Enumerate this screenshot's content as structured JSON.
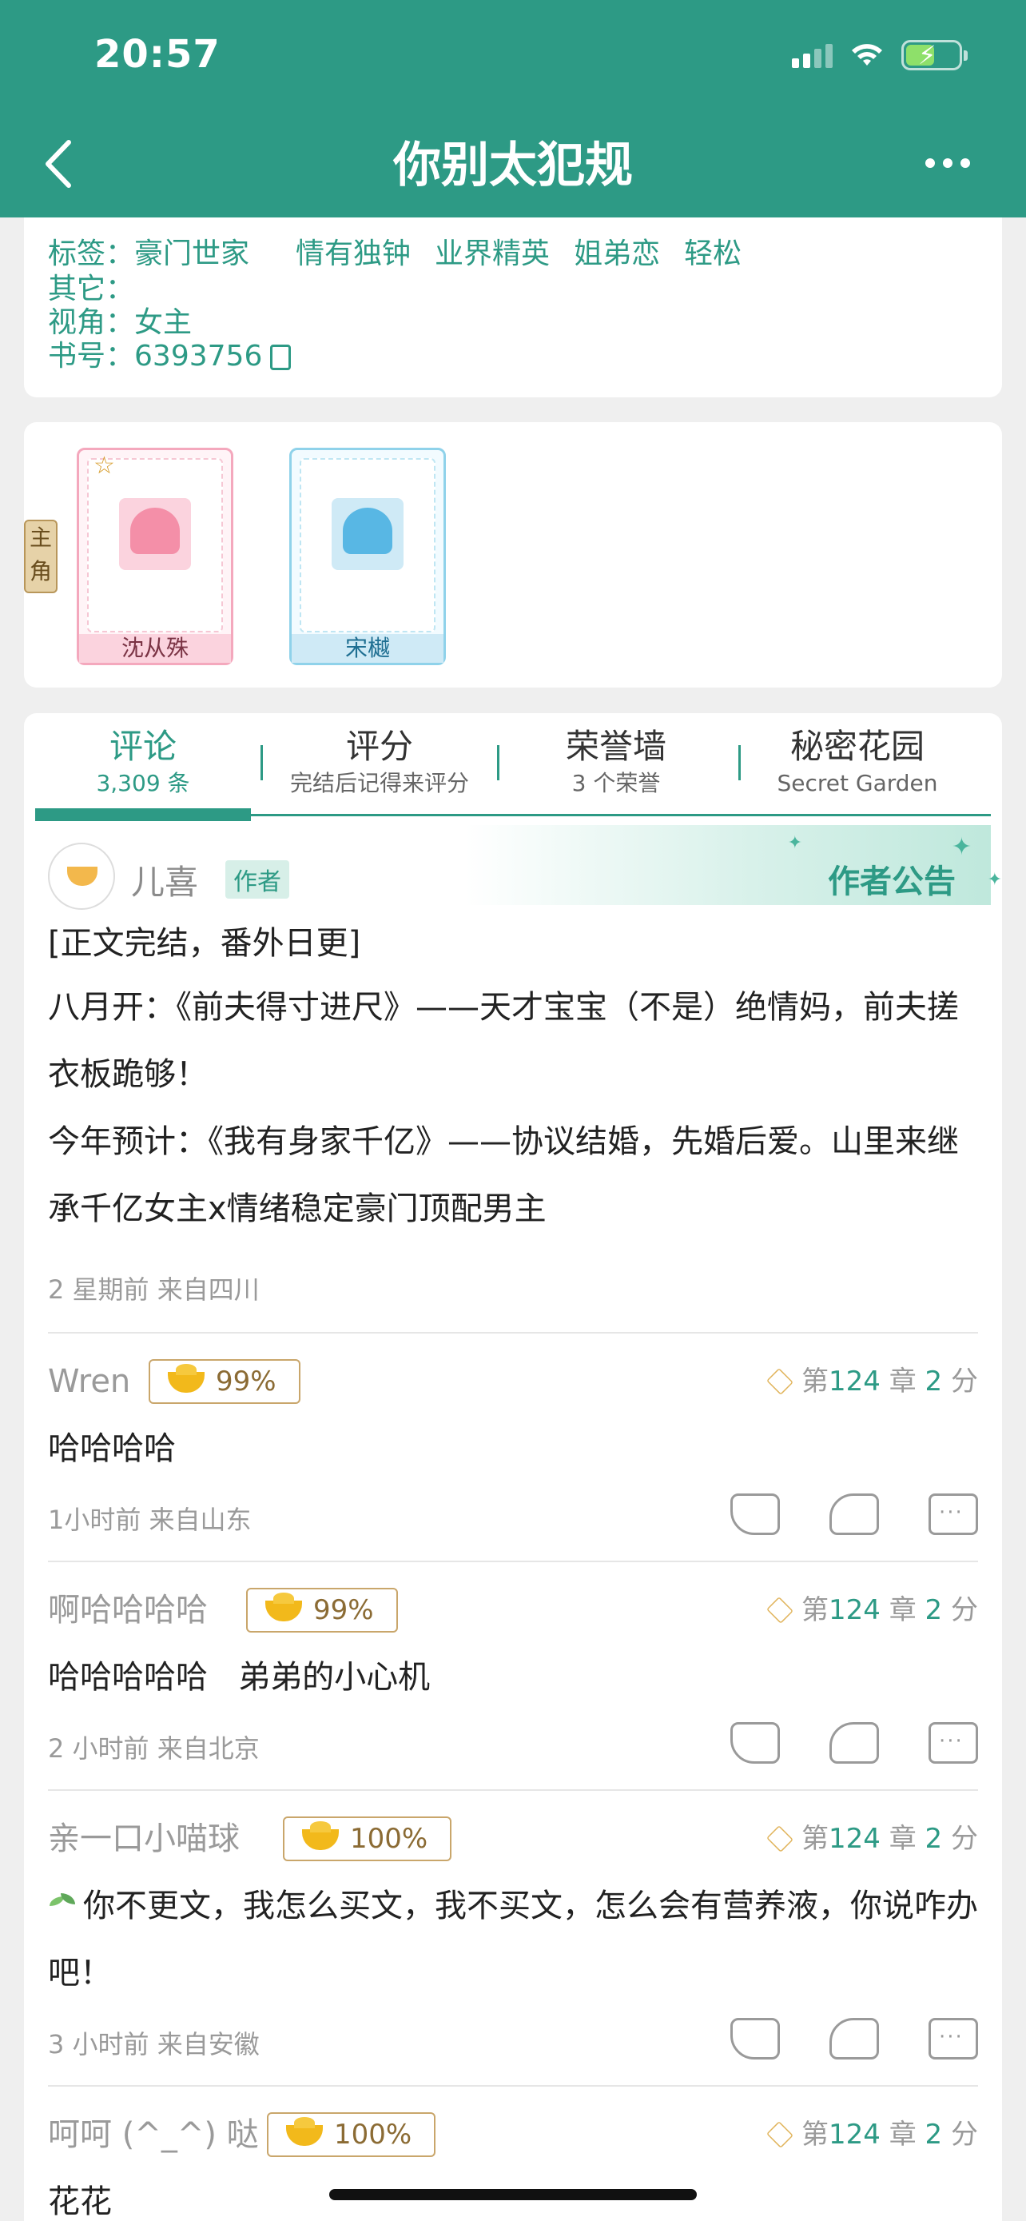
{
  "status": {
    "time": "20:57"
  },
  "header": {
    "title": "你别太犯规"
  },
  "info": {
    "tags_label": "标签：",
    "tags": [
      "豪门世家",
      "情有独钟",
      "业界精英",
      "姐弟恋",
      "轻松"
    ],
    "other_label": "其它：",
    "perspective_label": "视角：",
    "perspective": "女主",
    "book_label": "书号：",
    "book_id": "6393756"
  },
  "roles": {
    "badge": "主\n角",
    "items": [
      {
        "name": "沈从殊"
      },
      {
        "name": "宋樾"
      }
    ]
  },
  "tabs": [
    {
      "title": "评论",
      "sub": "3,309 条"
    },
    {
      "title": "评分",
      "sub": "完结后记得来评分"
    },
    {
      "title": "荣誉墙",
      "sub": "3 个荣誉"
    },
    {
      "title": "秘密花园",
      "sub": "Secret Garden"
    }
  ],
  "author_post": {
    "name": "儿喜",
    "badge": "作者",
    "notice_label": "作者公告",
    "lines": [
      "[正文完结，番外日更]",
      "八月开：《前夫得寸进尺》——天才宝宝（不是）绝情妈，前夫搓衣板跪够！",
      "今年预计：《我有身家千亿》——协议结婚，先婚后爱。山里来继承千亿女主x情绪稳定豪门顶配男主"
    ],
    "meta": "2 星期前  来自四川"
  },
  "comments": [
    {
      "user": "Wren",
      "percent": "99%",
      "chapter_prefix": "第",
      "chapter_num": "124",
      "chapter_suffix": "章",
      "score_num": "2",
      "score_suffix": "分",
      "text": "哈哈哈哈",
      "meta": "1小时前  来自山东"
    },
    {
      "user": "啊哈哈哈哈",
      "percent": "99%",
      "chapter_prefix": "第",
      "chapter_num": "124",
      "chapter_suffix": "章",
      "score_num": "2",
      "score_suffix": "分",
      "text": "哈哈哈哈哈   弟弟的小心机",
      "meta": "2 小时前  来自北京"
    },
    {
      "user": "亲一口小喵球",
      "percent": "100%",
      "chapter_prefix": "第",
      "chapter_num": "124",
      "chapter_suffix": "章",
      "score_num": "2",
      "score_suffix": "分",
      "text": "你不更文，我怎么买文，我不买文，怎么会有营养液，你说咋办吧！",
      "meta": "3 小时前  来自安徽"
    },
    {
      "user": "呵呵 (^_^) 哒",
      "percent": "100%",
      "chapter_prefix": "第",
      "chapter_num": "124",
      "chapter_suffix": "章",
      "score_num": "2",
      "score_suffix": "分",
      "text": "花花",
      "meta": ""
    }
  ]
}
